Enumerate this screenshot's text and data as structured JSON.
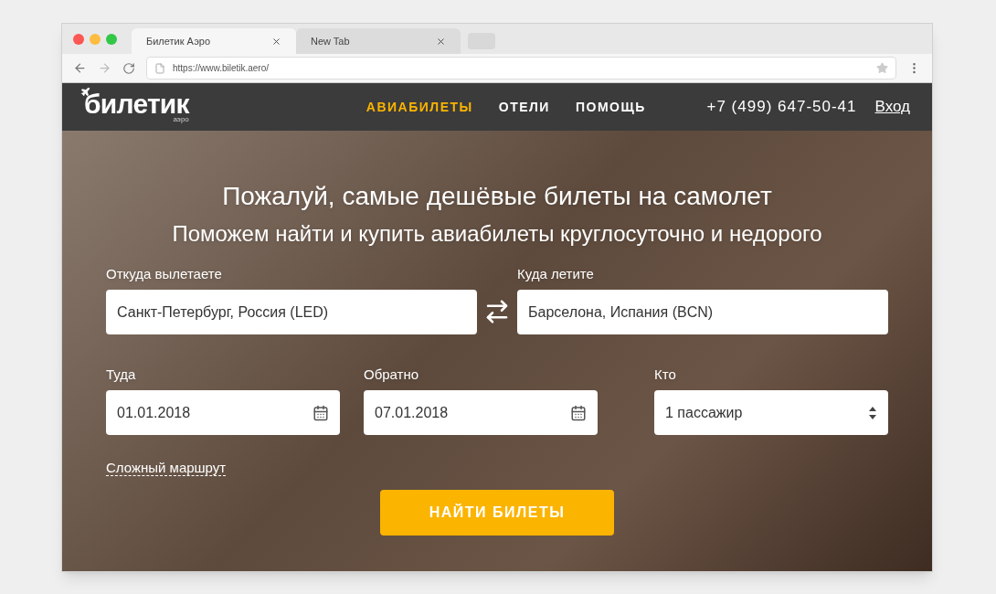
{
  "browser": {
    "tabs": [
      {
        "title": "Билетик Аэро",
        "selected": true
      },
      {
        "title": "New Tab",
        "selected": false
      }
    ],
    "url": "https://www.biletik.aero/"
  },
  "header": {
    "logo": {
      "name": "билетик",
      "sub": "аэро"
    },
    "nav": [
      {
        "label": "АВИАБИЛЕТЫ",
        "selected": true
      },
      {
        "label": "ОТЕЛИ",
        "selected": false
      },
      {
        "label": "ПОМОЩЬ",
        "selected": false
      }
    ],
    "phone": "+7 (499) 647-50-41",
    "login": "Вход"
  },
  "hero": {
    "title": "Пожалуй, самые дешёвые билеты на самолет",
    "subtitle": "Поможем найти и купить авиабилеты круглосуточно и недорого",
    "from": {
      "label": "Откуда вылетаете",
      "value": "Санкт-Петербург, Россия (LED)"
    },
    "to": {
      "label": "Куда летите",
      "value": "Барселона, Испания (BCN)"
    },
    "depart": {
      "label": "Туда",
      "value": "01.01.2018"
    },
    "return": {
      "label": "Обратно",
      "value": "07.01.2018"
    },
    "passengers": {
      "label": "Кто",
      "value": "1 пассажир"
    },
    "complex_route": "Сложный маршрут",
    "search_button": "НАЙТИ БИЛЕТЫ"
  }
}
